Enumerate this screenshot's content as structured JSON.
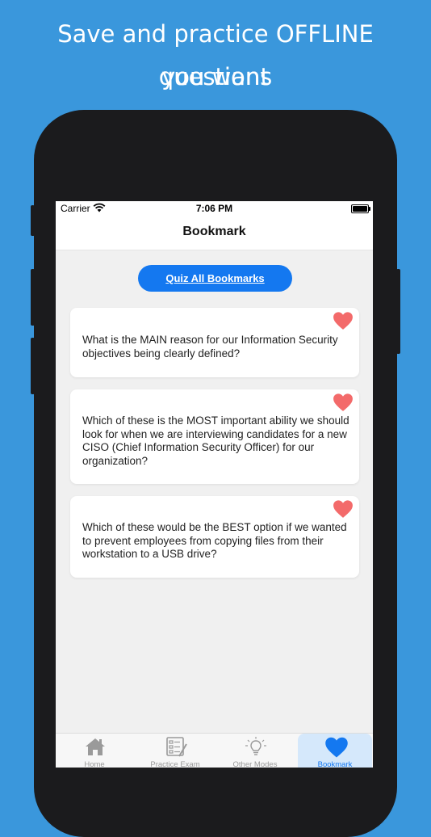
{
  "headline": {
    "line1": "Save and practice OFFLINE questions",
    "line2": "you want"
  },
  "status_bar": {
    "carrier": "Carrier",
    "time": "7:06 PM",
    "wifi_icon": "wifi-icon",
    "battery_icon": "battery-icon"
  },
  "nav": {
    "title": "Bookmark"
  },
  "quiz_button": {
    "label": "Quiz All Bookmarks"
  },
  "bookmarks": [
    {
      "question": "What is the MAIN reason for our Information Security objectives being clearly defined?",
      "icon": "heart-icon"
    },
    {
      "question": "Which of these is the MOST important ability we should look for when we are interviewing candidates for a new CISO (Chief Information Security Officer) for our organization?",
      "icon": "heart-icon"
    },
    {
      "question": "Which of these would be the BEST option if we wanted to prevent employees from copying files from their workstation to a USB drive?",
      "icon": "heart-icon"
    }
  ],
  "tab_bar": {
    "tabs": [
      {
        "label": "Home",
        "icon": "home-icon"
      },
      {
        "label": "Practice Exam",
        "icon": "exam-icon"
      },
      {
        "label": "Other Modes",
        "icon": "lightbulb-icon"
      },
      {
        "label": "Bookmark",
        "icon": "heart-icon",
        "selected": true
      }
    ]
  },
  "colors": {
    "background": "#3a97dc",
    "accent": "#1478f0",
    "heart": "#f36a6a",
    "tab_active_bg": "#d5e8fb",
    "tab_inactive": "#9a9a9a"
  }
}
